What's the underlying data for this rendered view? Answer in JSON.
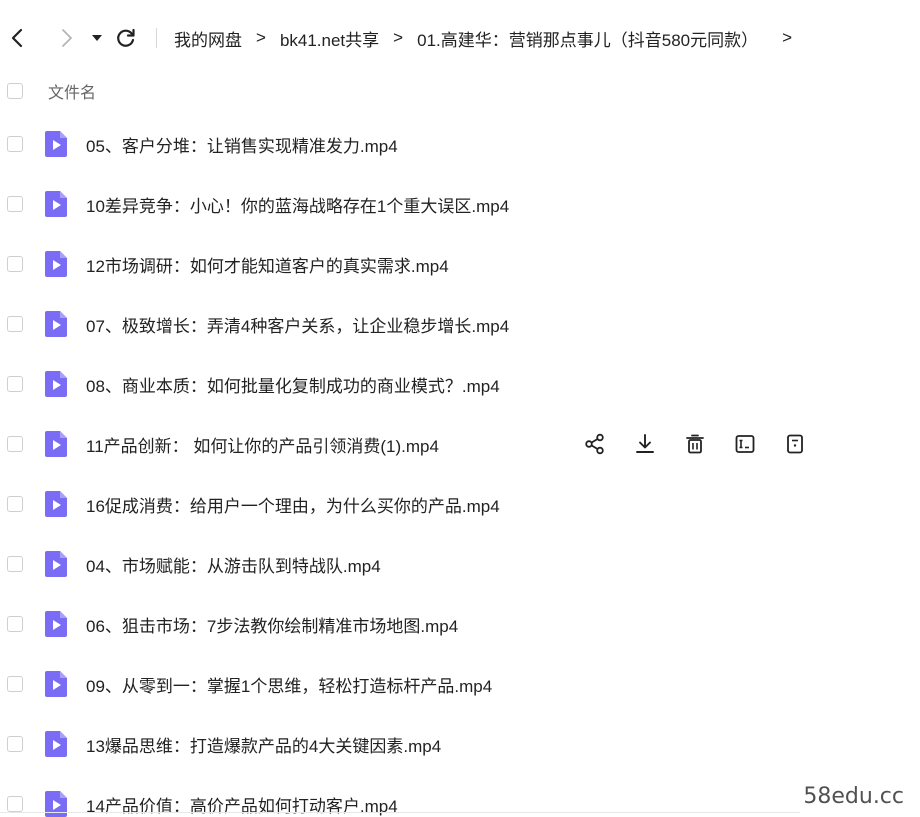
{
  "breadcrumb": {
    "items": [
      "我的网盘",
      "bk41.net共享",
      "01.高建华：营销那点事儿（抖音580元同款）"
    ],
    "separator": ">"
  },
  "header": {
    "column_label": "文件名"
  },
  "files": [
    "05、客户分堆：让销售实现精准发力.mp4",
    "10差异竞争：小心！你的蓝海战略存在1个重大误区.mp4",
    "12市场调研：如何才能知道客户的真实需求.mp4",
    "07、极致增长：弄清4种客户关系，让企业稳步增长.mp4",
    "08、商业本质：如何批量化复制成功的商业模式？.mp4",
    "11产品创新： 如何让你的产品引领消费(1).mp4",
    "16促成消费：给用户一个理由，为什么买你的产品.mp4",
    "04、市场赋能：从游击队到特战队.mp4",
    "06、狙击市场：7步法教你绘制精准市场地图.mp4",
    "09、从零到一：掌握1个思维，轻松打造标杆产品.mp4",
    "13爆品思维：打造爆款产品的4大关键因素.mp4",
    "14产品价值：高价产品如何打动客户.mp4"
  ],
  "hovered_row_index": 5,
  "row_actions": [
    "share-icon",
    "download-icon",
    "delete-icon",
    "rename-icon",
    "more-icon"
  ],
  "watermark": "58edu.cc",
  "colors": {
    "file_icon": "#7b6cf6",
    "file_icon_light": "#a99ff9"
  }
}
